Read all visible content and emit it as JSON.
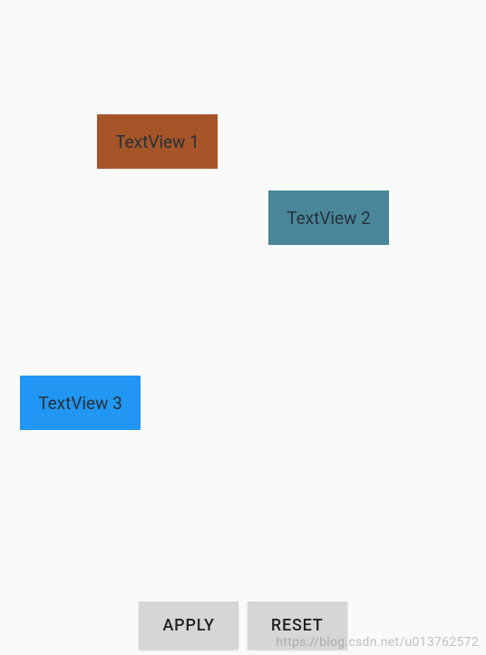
{
  "textviews": {
    "tv1": {
      "label": "TextView 1",
      "color": "#a65529"
    },
    "tv2": {
      "label": "TextView 2",
      "color": "#4a8699"
    },
    "tv3": {
      "label": "TextView 3",
      "color": "#2196f3"
    }
  },
  "buttons": {
    "apply": "APPLY",
    "reset": "RESET"
  },
  "watermark": "https://blog.csdn.net/u013762572"
}
